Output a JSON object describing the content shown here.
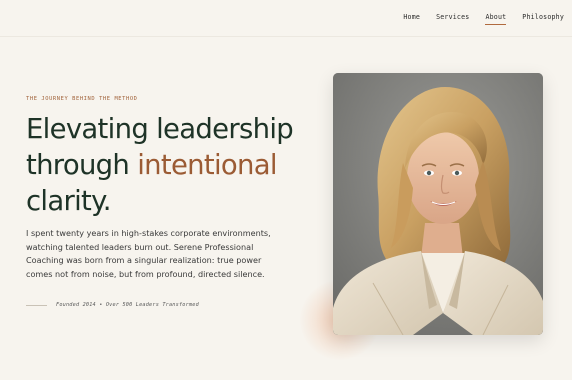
{
  "nav": {
    "items": [
      {
        "label": "Home",
        "active": false
      },
      {
        "label": "Services",
        "active": false
      },
      {
        "label": "About",
        "active": true
      },
      {
        "label": "Philosophy",
        "active": false
      }
    ]
  },
  "hero": {
    "eyebrow": "The Journey Behind the Method",
    "headline_line1": "Elevating leadership",
    "headline_line2_prefix": "through ",
    "headline_accent": "intentional",
    "headline_line3": "clarity.",
    "body": "I spent twenty years in high-stakes corporate environments, watching talented leaders burn out. Serene Professional Coaching was born from a singular realization: true power comes not from noise, but from profound, directed silence.",
    "meta": "Founded 2014 • Over 500 Leaders Transformed"
  },
  "colors": {
    "background": "#f7f4ee",
    "headline": "#1e3327",
    "accent": "#9b5b34",
    "eyebrow": "#a2643c"
  }
}
